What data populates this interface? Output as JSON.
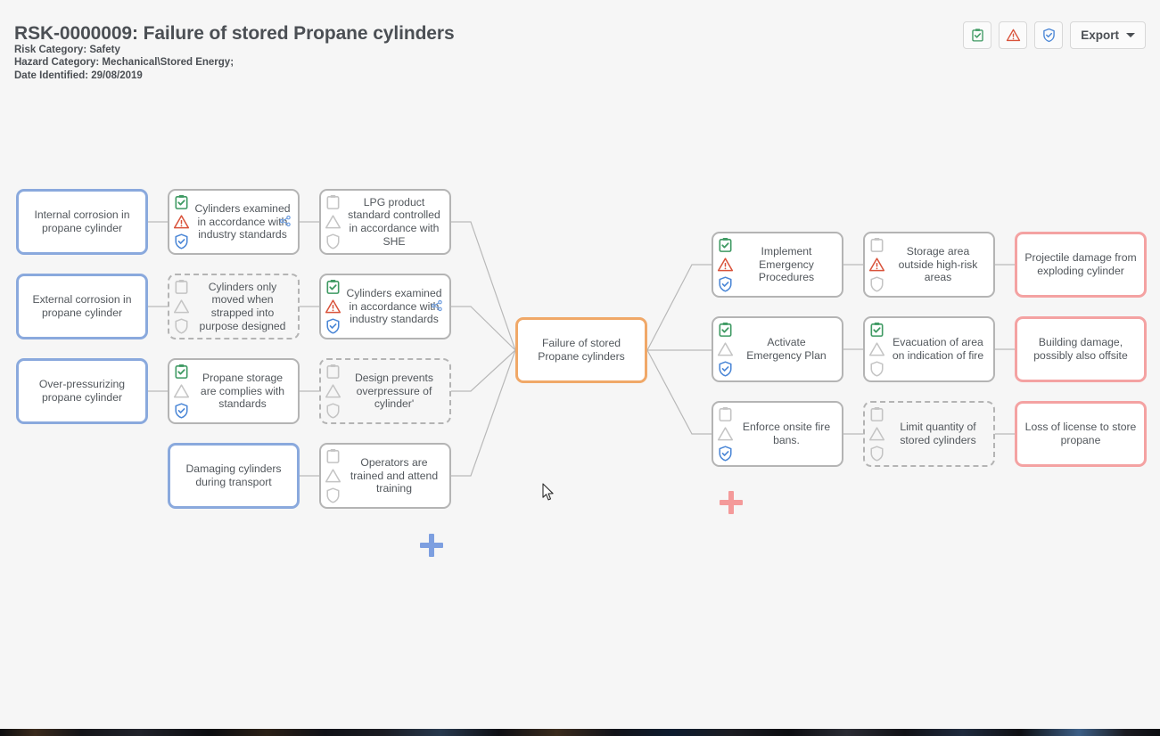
{
  "header": {
    "title": "RSK-0000009: Failure of stored Propane cylinders",
    "risk_category": "Risk Category: Safety",
    "hazard_category": "Hazard Category: Mechanical\\Stored Energy;",
    "date_identified": "Date Identified: 29/08/2019"
  },
  "toolbar": {
    "buttons": [
      {
        "name": "tasks-icon",
        "icon": "clipboard-check-icon",
        "state": "active"
      },
      {
        "name": "hazards-icon",
        "icon": "warning-triangle-icon",
        "state": "active"
      },
      {
        "name": "controls-icon",
        "icon": "shield-check-icon",
        "state": "active"
      }
    ],
    "export_label": "Export"
  },
  "diagram": {
    "hazard": {
      "label": "Failure of stored Propane cylinders"
    },
    "threats": [
      {
        "label": "Internal corrosion in propane cylinder"
      },
      {
        "label": "External corrosion in propane cylinder"
      },
      {
        "label": "Over-pressurizing propane cylinder"
      },
      {
        "label": "Damaging cylinders during transport"
      }
    ],
    "preventive_barriers": [
      {
        "label": "Cylinders examined in accordance with industry standards",
        "style": "solid",
        "badges": [
          "clipboard-active",
          "warning-active",
          "shield-active"
        ],
        "share": true
      },
      {
        "label": "LPG product standard controlled in accordance with SHE",
        "style": "solid",
        "badges": [
          "clipboard-inactive",
          "warning-inactive",
          "shield-inactive"
        ],
        "share": false
      },
      {
        "label": "Cylinders only moved when strapped into purpose designed",
        "style": "dashed",
        "badges": [
          "clipboard-inactive",
          "warning-inactive",
          "shield-inactive"
        ],
        "share": false
      },
      {
        "label": "Cylinders examined in accordance with industry standards",
        "style": "solid",
        "badges": [
          "clipboard-active",
          "warning-active",
          "shield-active"
        ],
        "share": true
      },
      {
        "label": "Propane storage are complies with standards",
        "style": "solid",
        "badges": [
          "clipboard-active",
          "warning-inactive",
          "shield-active"
        ],
        "share": false
      },
      {
        "label": "Design prevents overpressure of cylinder'",
        "style": "dashed",
        "badges": [
          "clipboard-inactive",
          "warning-inactive",
          "shield-inactive"
        ],
        "share": false
      },
      {
        "label": "Operators are trained and attend training",
        "style": "solid",
        "badges": [
          "clipboard-inactive",
          "warning-inactive",
          "shield-inactive"
        ],
        "share": false
      }
    ],
    "mitigating_barriers": [
      {
        "label": "Implement Emergency Procedures",
        "style": "solid",
        "badges": [
          "clipboard-active",
          "warning-active",
          "shield-active"
        ],
        "share": false
      },
      {
        "label": "Storage area outside high-risk areas",
        "style": "solid",
        "badges": [
          "clipboard-inactive",
          "warning-active",
          "shield-inactive"
        ],
        "share": false
      },
      {
        "label": "Activate Emergency Plan",
        "style": "solid",
        "badges": [
          "clipboard-active",
          "warning-inactive",
          "shield-active"
        ],
        "share": false
      },
      {
        "label": "Evacuation of area on indication of fire",
        "style": "solid",
        "badges": [
          "clipboard-active",
          "warning-inactive",
          "shield-inactive"
        ],
        "share": false
      },
      {
        "label": "Enforce onsite fire bans.",
        "style": "solid",
        "badges": [
          "clipboard-inactive",
          "warning-inactive",
          "shield-active"
        ],
        "share": false
      },
      {
        "label": "Limit quantity of stored cylinders",
        "style": "dashed",
        "badges": [
          "clipboard-inactive",
          "warning-inactive",
          "shield-inactive"
        ],
        "share": false
      }
    ],
    "consequences": [
      {
        "label": "Projectile damage from exploding cylinder"
      },
      {
        "label": "Building damage, possibly also offsite"
      },
      {
        "label": "Loss of license to store propane"
      }
    ]
  },
  "colors": {
    "threat_border": "#8aa9dd",
    "hazard_border": "#f0a868",
    "consequence_border": "#f4a2a2",
    "barrier_border": "#b4b4b4",
    "badge_active_green": "#3f9a63",
    "badge_active_orange": "#d9533b",
    "badge_active_blue": "#4a86d6",
    "badge_inactive": "#c4c4c4",
    "canvas_bg": "#f6f6f6",
    "text": "#52575c"
  }
}
